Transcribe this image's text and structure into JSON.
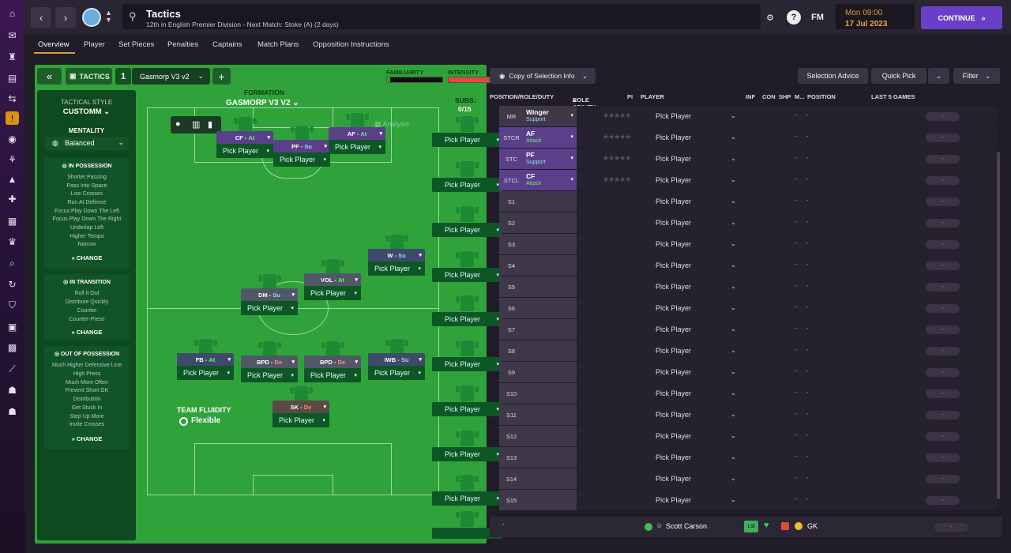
{
  "header": {
    "title": "Tactics",
    "subtitle": "12th in English Premier Division - Next Match: Stoke (A) (2 days)",
    "fm": "FM",
    "day_time": "Mon 09:00",
    "date": "17 Jul 2023",
    "continue_label": "CONTINUE",
    "continue_icon": "»"
  },
  "tabs": [
    "Overview",
    "Player",
    "Set Pieces",
    "Penalties",
    "Captains",
    "Match Plans",
    "Opposition Instructions"
  ],
  "toolbar": {
    "tactics_label": "TACTICS",
    "tactic_number": "1",
    "tactic_name": "Gasmorp V3 v2",
    "familiarity_label": "FAMILIARITY",
    "intensity_label": "INTENSITY",
    "familiarity_level": 0.05,
    "intensity_level": 0.92
  },
  "left": {
    "style_label": "TACTICAL STYLE",
    "style_value": "CUSTOMM",
    "mentality_label": "MENTALITY",
    "mentality_value": "Balanced",
    "in_possession": {
      "title": "IN POSSESSION",
      "items": [
        "Shorter Passing",
        "Pass Into Space",
        "Low Crosses",
        "Run At Defence",
        "Focus Play Down The Left",
        "Focus Play Down The Right",
        "Underlap Left",
        "Higher Tempo",
        "Narrow"
      ],
      "change": "CHANGE"
    },
    "in_transition": {
      "title": "IN TRANSITION",
      "items": [
        "Roll It Out",
        "Distribute Quickly",
        "Counter",
        "Counter-Press"
      ],
      "change": "CHANGE"
    },
    "out_of_possession": {
      "title": "OUT OF POSSESSION",
      "items": [
        "Much Higher Defensive Line",
        "High Press",
        "Much More Often",
        "Prevent Short GK",
        "Distribution",
        "Get Stuck In",
        "Step Up More",
        "Invite Crosses"
      ],
      "change": "CHANGE"
    }
  },
  "formation": {
    "label": "FORMATION",
    "name": "GASMORP V3 V2",
    "analysis": "Analysis",
    "fluidity_label": "TEAM FLUIDITY",
    "fluidity_value": "Flexible",
    "pick_label": "Pick Player",
    "slots": [
      {
        "role": "CF",
        "duty": "At",
        "duty_class": "dutyAt",
        "bg": "#5a3f8a"
      },
      {
        "role": "PF",
        "duty": "Su",
        "duty_class": "dutySu",
        "bg": "#5a3f8a"
      },
      {
        "role": "AF",
        "duty": "At",
        "duty_class": "dutyAt",
        "bg": "#5a3f8a"
      },
      {
        "role": "W",
        "duty": "Su",
        "duty_class": "dutySu",
        "bg": "#3e4a6a"
      },
      {
        "role": "VOL",
        "duty": "At",
        "duty_class": "dutyAt",
        "bg": "#505866"
      },
      {
        "role": "DM",
        "duty": "Su",
        "duty_class": "dutySu",
        "bg": "#505866"
      },
      {
        "role": "FB",
        "duty": "At",
        "duty_class": "dutyAt",
        "bg": "#3e4a6a"
      },
      {
        "role": "BPD",
        "duty": "De",
        "duty_class": "dutyDe",
        "bg": "#505866"
      },
      {
        "role": "BPD",
        "duty": "De",
        "duty_class": "dutyDe",
        "bg": "#505866"
      },
      {
        "role": "IWB",
        "duty": "Su",
        "duty_class": "dutySu",
        "bg": "#3e4a6a"
      },
      {
        "role": "SK",
        "duty": "De",
        "duty_class": "dutyDe",
        "bg": "#5a4a44"
      }
    ]
  },
  "subs": {
    "label": "SUBS:",
    "count": "0/15",
    "pick_label": "Pick Player"
  },
  "right": {
    "copy_label": "Copy of Selection Info",
    "selection_advice": "Selection Advice",
    "quick_pick": "Quick Pick",
    "filter": "Filter",
    "columns": {
      "position": "POSITION/ROLE/DUTY",
      "role_ability": "ROLE ABILITY",
      "pi": "PI",
      "player": "PLAYER",
      "inf": "INF",
      "con": "CON",
      "shp": "SHP",
      "m": "M...",
      "pos": "POSITION",
      "last5": "LAST 5 GAMES"
    },
    "rows": [
      {
        "pos": "MR",
        "role": "Winger",
        "duty": "Support",
        "duty_color": "#9bd8ff",
        "selected": false
      },
      {
        "pos": "STCR",
        "role": "AF",
        "duty": "Attack",
        "duty_color": "#6ef070",
        "selected": true
      },
      {
        "pos": "STC",
        "role": "PF",
        "duty": "Support",
        "duty_color": "#9bd8ff",
        "selected": true
      },
      {
        "pos": "STCL",
        "role": "CF",
        "duty": "Attack",
        "duty_color": "#6ef070",
        "selected": true
      },
      {
        "pos": "S1",
        "role": "",
        "duty": "",
        "selected": false
      },
      {
        "pos": "S2",
        "role": "",
        "duty": "",
        "selected": false
      },
      {
        "pos": "S3",
        "role": "",
        "duty": "",
        "selected": false
      },
      {
        "pos": "S4",
        "role": "",
        "duty": "",
        "selected": false
      },
      {
        "pos": "S5",
        "role": "",
        "duty": "",
        "selected": false
      },
      {
        "pos": "S6",
        "role": "",
        "duty": "",
        "selected": false
      },
      {
        "pos": "S7",
        "role": "",
        "duty": "",
        "selected": false
      },
      {
        "pos": "S8",
        "role": "",
        "duty": "",
        "selected": false
      },
      {
        "pos": "S9",
        "role": "",
        "duty": "",
        "selected": false
      },
      {
        "pos": "S10",
        "role": "",
        "duty": "",
        "selected": false
      },
      {
        "pos": "S11",
        "role": "",
        "duty": "",
        "selected": false
      },
      {
        "pos": "S12",
        "role": "",
        "duty": "",
        "selected": false
      },
      {
        "pos": "S13",
        "role": "",
        "duty": "",
        "selected": false
      },
      {
        "pos": "S14",
        "role": "",
        "duty": "",
        "selected": false
      },
      {
        "pos": "S15",
        "role": "",
        "duty": "",
        "selected": false
      }
    ],
    "pick_label": "Pick Player",
    "dash": "-",
    "bottom_row": {
      "pos": "-",
      "player": "Scott Carson",
      "badge": "Lst",
      "position": "GK"
    }
  },
  "colors": {
    "accent": "#6a3fc8",
    "pitch_green": "#2fa33a",
    "selected_row": "#5a3f8a",
    "date_orange": "#f0a83a"
  }
}
